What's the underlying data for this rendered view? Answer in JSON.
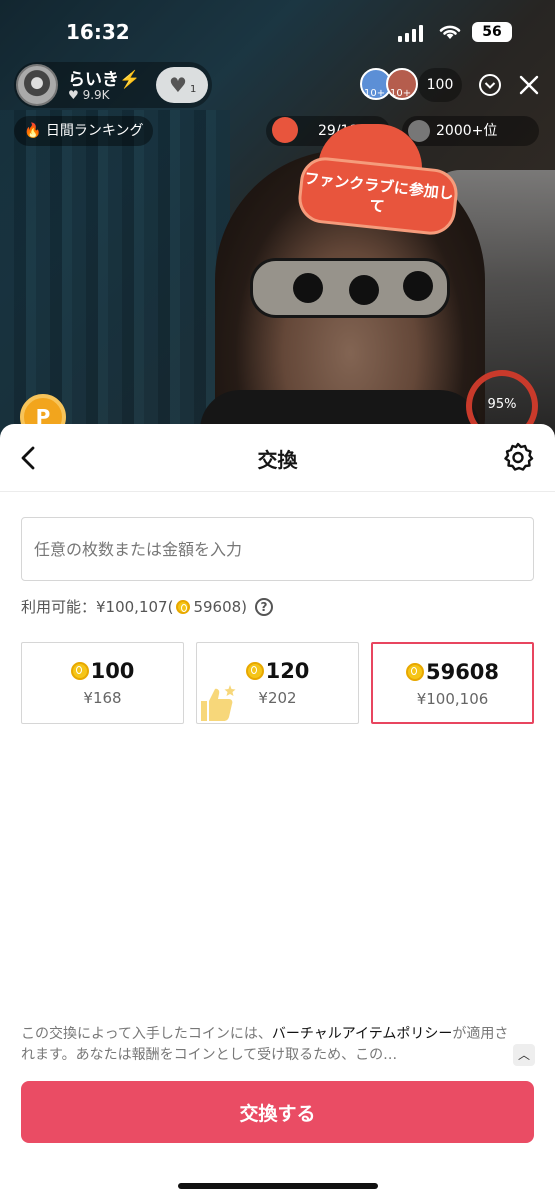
{
  "status_bar": {
    "time": "16:32",
    "battery": "56"
  },
  "live": {
    "host_name": "らいき⚡️",
    "host_likes": "♥ 9.9K",
    "follow_count": "1",
    "viewer_badges": [
      "10+",
      "10+"
    ],
    "viewer_count": "100",
    "ranking_chip": "日間ランキング",
    "progress_chip": "29/119",
    "rank_chip": "2000+位",
    "promo": "ファンクラブに参加して",
    "coin_letter": "P",
    "gauge_value": "95%"
  },
  "sheet": {
    "title": "交換",
    "input_placeholder": "任意の枚数または金額を入力",
    "available_prefix": "利用可能：¥100,107(",
    "available_coins": "59608",
    "available_suffix": ")",
    "help_glyph": "?",
    "packages": [
      {
        "coins": "100",
        "price": "¥168",
        "selected": false
      },
      {
        "coins": "120",
        "price": "¥202",
        "selected": false
      },
      {
        "coins": "59608",
        "price": "¥100,106",
        "selected": true
      }
    ],
    "policy_prefix": "この交換によって入手したコインには、",
    "policy_link": "バーチャルアイテムポリシー",
    "policy_suffix": "が適用されます。あなたは報酬をコインとして受け取るため、この…",
    "cta_label": "交換する"
  }
}
